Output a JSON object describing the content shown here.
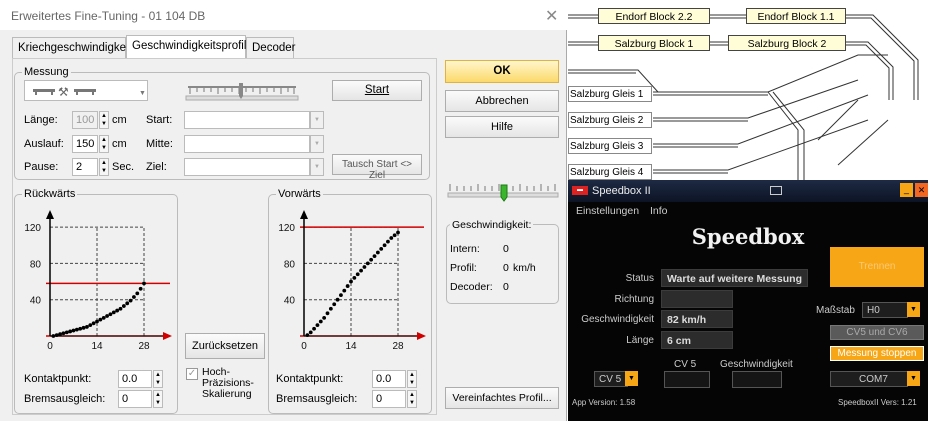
{
  "dialog": {
    "title": "Erweitertes Fine-Tuning - 01 104 DB",
    "close_glyph": "✕",
    "tabs": [
      "Kriechgeschwindigkeit",
      "Geschwindigkeitsprofil",
      "Decoder"
    ],
    "measure": {
      "title": "Messung",
      "length_label": "Länge:",
      "length_value": "100",
      "length_unit": "cm",
      "runout_label": "Auslauf:",
      "runout_value": "150",
      "runout_unit": "cm",
      "pause_label": "Pause:",
      "pause_value": "2",
      "pause_unit": "Sec.",
      "start_label": "Start:",
      "mid_label": "Mitte:",
      "goal_label": "Ziel:",
      "start_button": "Start",
      "swap_button": "Tausch Start <> Ziel"
    },
    "backward": {
      "title": "Rückwärts",
      "contact_label": "Kontaktpunkt:",
      "contact_value": "0.0",
      "brake_label": "Bremsausgleich:",
      "brake_value": "0"
    },
    "forward": {
      "title": "Vorwärts",
      "contact_label": "Kontaktpunkt:",
      "contact_value": "0.0",
      "brake_label": "Bremsausgleich:",
      "brake_value": "0"
    },
    "reset_button": "Zurücksetzen",
    "precision_label": "Hoch-\nPräzisions-\nSkalierung",
    "buttons": {
      "ok": "OK",
      "cancel": "Abbrechen",
      "help": "Hilfe",
      "simple_profile": "Vereinfachtes Profil..."
    },
    "speed": {
      "title": "Geschwindigkeit:",
      "intern_label": "Intern:",
      "intern_value": "0",
      "profile_label": "Profil:",
      "profile_value": "0",
      "profile_unit": "km/h",
      "decoder_label": "Decoder:",
      "decoder_value": "0"
    }
  },
  "chart_data": [
    {
      "type": "scatter",
      "panel": "Rückwärts",
      "x_ticks": [
        "0",
        "14",
        "28"
      ],
      "y_ticks": [
        "40",
        "80",
        "120"
      ],
      "xlim": [
        0,
        28
      ],
      "ylim": [
        0,
        130
      ],
      "series": [
        {
          "x": [
            1,
            2,
            3,
            4,
            5,
            6,
            7,
            8,
            9,
            10,
            11,
            12,
            13,
            14,
            15,
            16,
            17,
            18,
            19,
            20,
            21,
            22,
            23,
            24,
            25,
            26,
            27,
            28
          ],
          "y": [
            0,
            1,
            2,
            3,
            4,
            5,
            6,
            7,
            8,
            9,
            10,
            12,
            14,
            16,
            18,
            20,
            22,
            24,
            26,
            28,
            30,
            33,
            36,
            39,
            43,
            47,
            52,
            58
          ]
        }
      ],
      "reference_lines": [
        {
          "y": 58,
          "color": "#d00000"
        },
        {
          "y": 0,
          "color": "#d00000"
        }
      ]
    },
    {
      "type": "scatter",
      "panel": "Vorwärts",
      "x_ticks": [
        "0",
        "14",
        "28"
      ],
      "y_ticks": [
        "40",
        "80",
        "120"
      ],
      "xlim": [
        0,
        28
      ],
      "ylim": [
        0,
        130
      ],
      "series": [
        {
          "x": [
            1,
            2,
            3,
            4,
            5,
            6,
            7,
            8,
            9,
            10,
            11,
            12,
            13,
            14,
            15,
            16,
            17,
            18,
            19,
            20,
            21,
            22,
            23,
            24,
            25,
            26,
            27,
            28
          ],
          "y": [
            1,
            4,
            8,
            12,
            16,
            20,
            25,
            30,
            35,
            40,
            45,
            50,
            55,
            60,
            64,
            68,
            72,
            76,
            80,
            84,
            88,
            92,
            96,
            100,
            104,
            108,
            111,
            114
          ]
        }
      ],
      "reference_lines": [
        {
          "y": 120,
          "color": "#d00000"
        },
        {
          "y": 0,
          "color": "#d00000"
        }
      ]
    }
  ],
  "track": {
    "blocks": [
      "Endorf Block 2.2",
      "Endorf Block 1.1",
      "Salzburg Block 1",
      "Salzburg Block 2"
    ],
    "gleise": [
      "Salzburg Gleis 1",
      "Salzburg Gleis 2",
      "Salzburg Gleis 3",
      "Salzburg Gleis 4"
    ]
  },
  "speedbox": {
    "title": "Speedbox II",
    "menu": [
      "Einstellungen",
      "Info"
    ],
    "heading": "Speedbox",
    "status_label": "Status",
    "status_value": "Warte auf weitere Messung",
    "direction_label": "Richtung",
    "direction_value": "",
    "speed_label": "Geschwindigkeit",
    "speed_value": "82 km/h",
    "length_label": "Länge",
    "length_value": "6 cm",
    "scale_label": "Maßstab",
    "scale_value": "H0",
    "separate_button": "Trennen",
    "cv_compare_button": "CV5 und CV6",
    "stop_button": "Messung stoppen",
    "cv_select": "CV 5",
    "cv5_label": "CV 5",
    "speed_col_label": "Geschwindigkeit",
    "com_select": "COM7",
    "app_version": "App Version: 1.58",
    "box_version": "SpeedboxII Vers: 1.21",
    "accent_color": "#f7a616"
  }
}
